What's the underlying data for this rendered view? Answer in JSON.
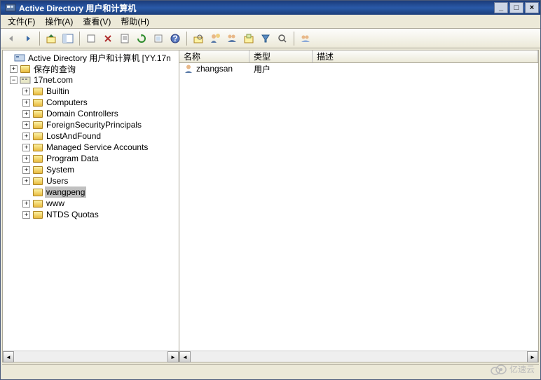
{
  "window": {
    "title": "Active Directory 用户和计算机"
  },
  "menu": {
    "file": "文件(F)",
    "action": "操作(A)",
    "view": "查看(V)",
    "help": "帮助(H)"
  },
  "tree": {
    "root": "Active Directory 用户和计算机 [YY.17n",
    "saved_queries": "保存的查询",
    "domain": "17net.com",
    "children": [
      "Builtin",
      "Computers",
      "Domain Controllers",
      "ForeignSecurityPrincipals",
      "LostAndFound",
      "Managed Service Accounts",
      "Program Data",
      "System",
      "Users",
      "wangpeng",
      "www",
      "NTDS Quotas"
    ],
    "selected": "wangpeng"
  },
  "list": {
    "columns": {
      "name": "名称",
      "type": "类型",
      "desc": "描述"
    },
    "rows": [
      {
        "name": "zhangsan",
        "type": "用户",
        "desc": ""
      }
    ]
  },
  "watermark": "亿速云"
}
